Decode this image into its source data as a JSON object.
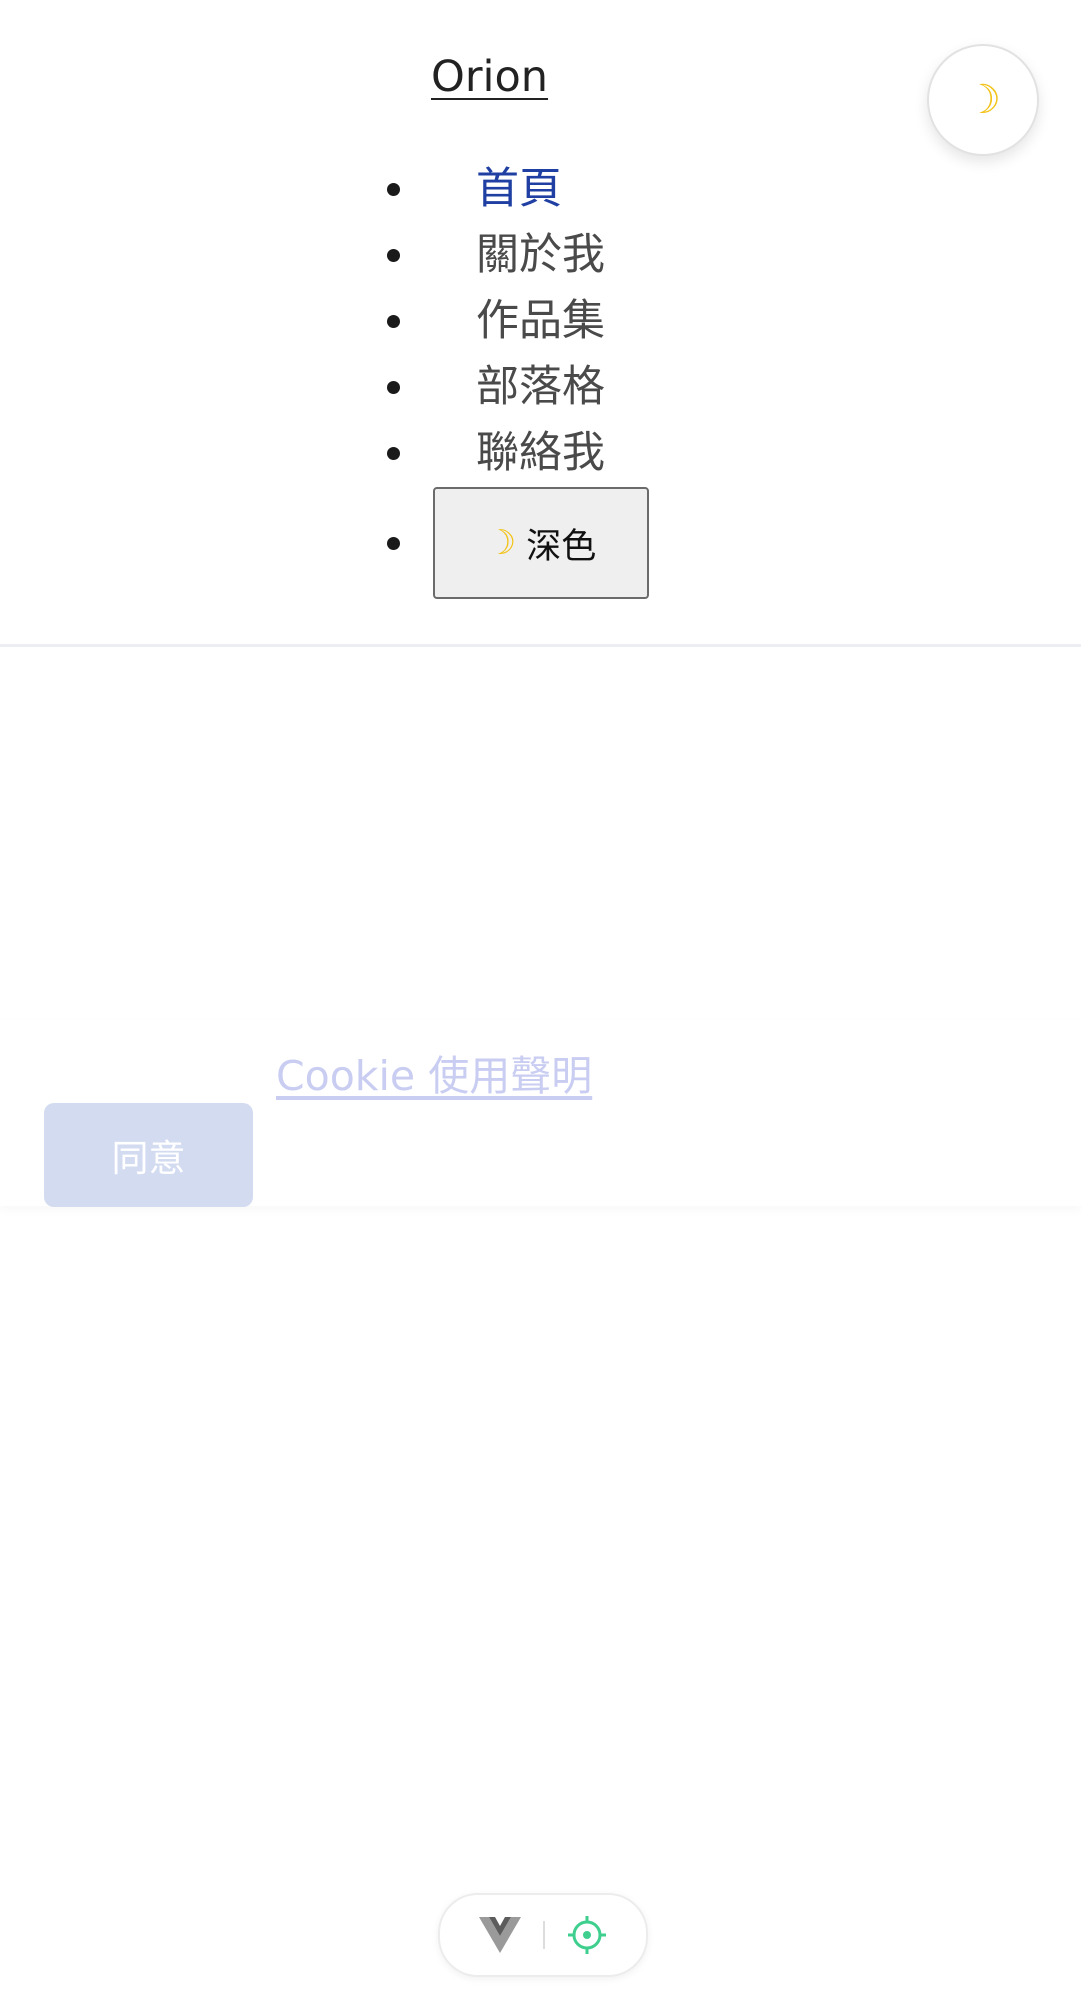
{
  "header": {
    "brand": "Orion",
    "theme_fab_icon": "moon-icon",
    "nav": {
      "items": [
        {
          "label": "首頁",
          "active": true
        },
        {
          "label": "關於我",
          "active": false
        },
        {
          "label": "作品集",
          "active": false
        },
        {
          "label": "部落格",
          "active": false
        },
        {
          "label": "聯絡我",
          "active": false
        }
      ],
      "theme_button_label": "深色",
      "theme_button_icon": "moon-icon"
    }
  },
  "cookie_banner": {
    "link_label": "Cookie 使用聲明",
    "agree_label": "同意"
  },
  "devtools": {
    "icons": [
      "vue-logo-icon",
      "crosshair-target-icon"
    ]
  },
  "colors": {
    "nav_active": "#1f3fa3",
    "nav_text": "#4a4a4a",
    "moon": "#f2c318",
    "agree_button_bg": "#d3dbf1",
    "cookie_link": "#c9cdf2",
    "devtools_target": "#3ecf8e"
  }
}
